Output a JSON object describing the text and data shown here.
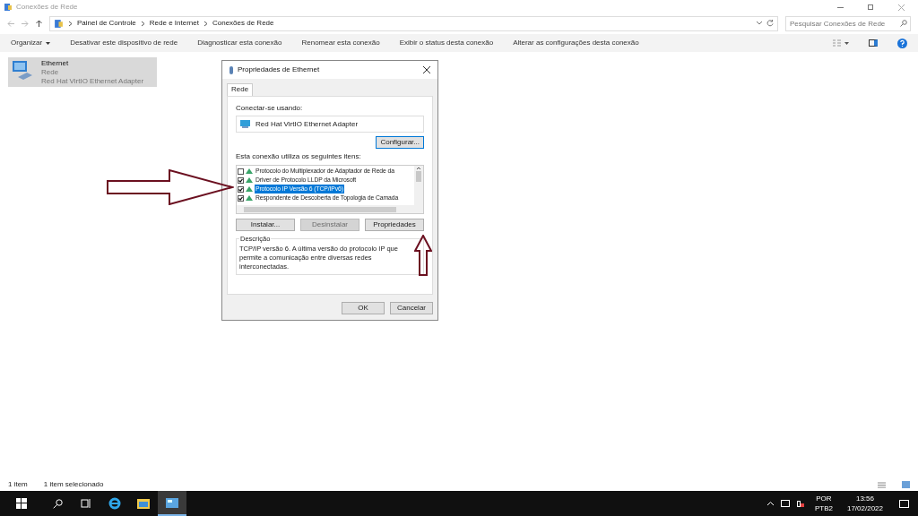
{
  "window": {
    "title": "Conexões de Rede"
  },
  "breadcrumb": [
    "Painel de Controle",
    "Rede e Internet",
    "Conexões de Rede"
  ],
  "search": {
    "placeholder": "Pesquisar Conexões de Rede"
  },
  "toolbar": [
    {
      "label": "Organizar",
      "dropdown": true
    },
    {
      "label": "Desativar este dispositivo de rede",
      "dropdown": false
    },
    {
      "label": "Diagnosticar esta conexão",
      "dropdown": false
    },
    {
      "label": "Renomear esta conexão",
      "dropdown": false
    },
    {
      "label": "Exibir o status desta conexão",
      "dropdown": false
    },
    {
      "label": "Alterar as configurações desta conexão",
      "dropdown": false
    }
  ],
  "connections": [
    {
      "name": "Ethernet",
      "network": "Rede",
      "adapter": "Red Hat VirtIO Ethernet Adapter",
      "selected": true
    }
  ],
  "dialog": {
    "title": "Propriedades de Ethernet",
    "tabs": [
      {
        "label": "Rede",
        "selected": true
      }
    ],
    "connect_label": "Conectar-se usando:",
    "adapter": "Red Hat VirtIO Ethernet Adapter",
    "configure": "Configurar...",
    "items_label": "Esta conexão utiliza os seguintes itens:",
    "items": [
      {
        "label": "Protocolo do Multiplexador de Adaptador de Rede da",
        "checked": false,
        "selected": false
      },
      {
        "label": "Driver de Protocolo LLDP da Microsoft",
        "checked": true,
        "selected": false
      },
      {
        "label": "Protocolo IP Versão 6 (TCP/IPv6)",
        "checked": true,
        "selected": true
      },
      {
        "label": "Respondente de Descoberta de Topologia de Camada",
        "checked": true,
        "selected": false
      }
    ],
    "buttons": [
      {
        "label": "Instalar...",
        "disabled": false
      },
      {
        "label": "Desinstalar",
        "disabled": true
      },
      {
        "label": "Propriedades",
        "disabled": false
      }
    ],
    "description_label": "Descrição",
    "description": "TCP/IP versão 6. A última versão do protocolo IP que permite a comunicação entre diversas redes interconectadas.",
    "footer": [
      "OK",
      "Cancelar"
    ]
  },
  "status_bar": [
    "1 item",
    "1 item selecionado"
  ],
  "taskbar": {
    "language": "POR",
    "layout": "PTB2",
    "time": "13:56",
    "date": "17/02/2022"
  }
}
